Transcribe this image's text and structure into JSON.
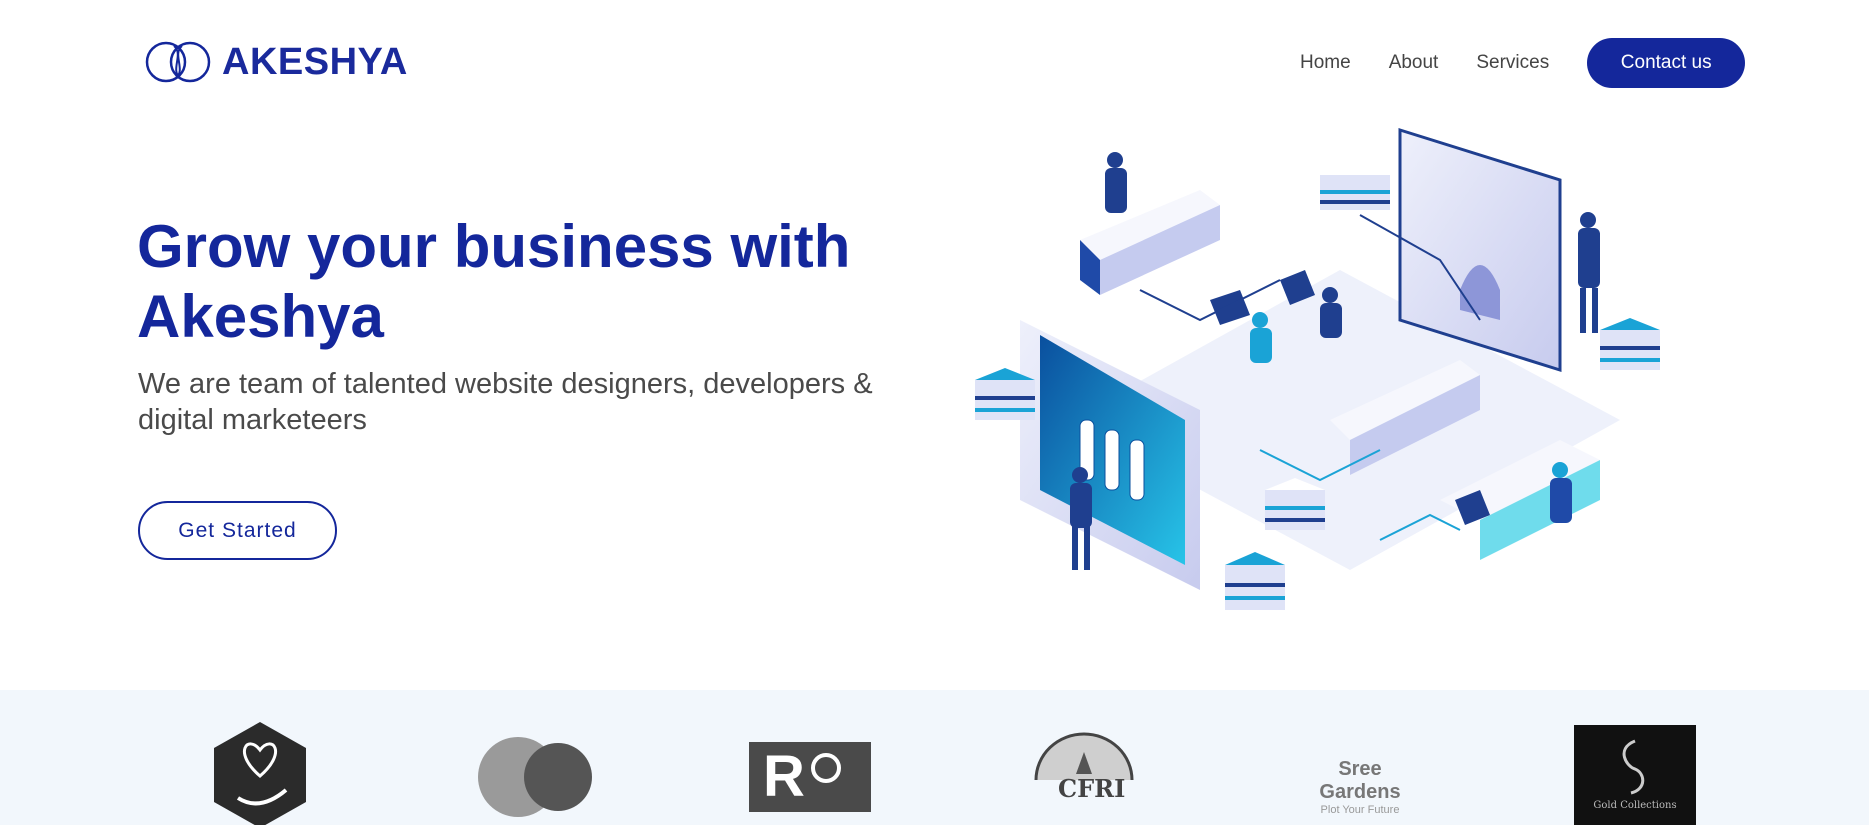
{
  "brand": {
    "name": "AKESHYA",
    "color": "#14279b"
  },
  "nav": {
    "links": [
      "Home",
      "About",
      "Services"
    ],
    "contact_label": "Contact us"
  },
  "hero": {
    "title": "Grow your business with Akeshya",
    "subtitle": "We are team of talented website designers, developers & digital marketeers",
    "cta_label": "Get Started"
  },
  "clients": {
    "background": "#f2f7fc",
    "logos": [
      {
        "icon": "heart-hand-logo"
      },
      {
        "icon": "overlapping-circles-logo"
      },
      {
        "icon": "ro-logo",
        "text": "R"
      },
      {
        "icon": "cfri-logo",
        "text": "CFRI"
      },
      {
        "icon": "sree-gardens-logo",
        "text": "Sree Gardens",
        "tagline": "Plot Your Future"
      },
      {
        "icon": "gold-collections-logo",
        "text": "Gold Collections"
      }
    ]
  }
}
